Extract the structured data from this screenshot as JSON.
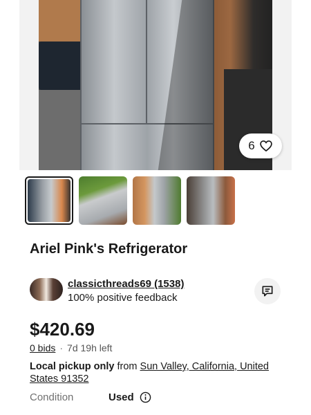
{
  "listing": {
    "title": "Ariel Pink's Refrigerator",
    "watch_count": "6",
    "price": "$420.69",
    "bids": "0 bids",
    "time_left": "7d 19h left",
    "pickup_bold": "Local pickup only",
    "pickup_from": " from ",
    "pickup_location": "Sun Valley, California, United States 91352",
    "condition_label": "Condition",
    "condition_value": "Used"
  },
  "seller": {
    "name": "classicthreads69",
    "feedback_count": "(1538)",
    "feedback_percent": "100% positive feedback"
  },
  "icons": {
    "heart": "heart-icon",
    "message": "message-icon",
    "info": "info-icon"
  },
  "colors": {
    "text": "#191919",
    "muted": "#707070",
    "pill_bg": "#ffffff"
  }
}
